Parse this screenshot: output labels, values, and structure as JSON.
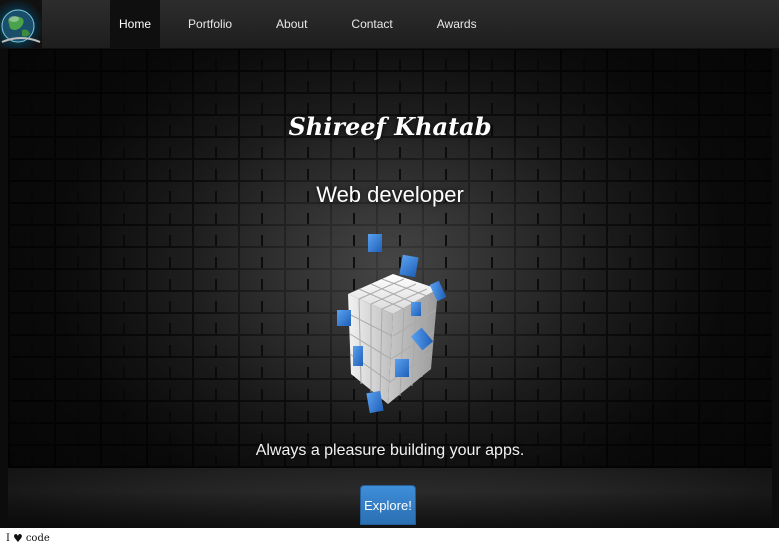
{
  "nav": {
    "logo_icon": "globe-logo-icon",
    "items": [
      {
        "label": "Home",
        "active": true
      },
      {
        "label": "Portfolio",
        "active": false
      },
      {
        "label": "About",
        "active": false
      },
      {
        "label": "Contact",
        "active": false
      },
      {
        "label": "Awards",
        "active": false
      }
    ]
  },
  "hero": {
    "name": "Shireef Khatab",
    "role": "Web developer",
    "image_icon": "cube-blocks-icon",
    "tagline": "Always a pleasure building your apps.",
    "button_label": "Explore!"
  },
  "footer": {
    "prefix": "I",
    "heart_icon": "heart-icon",
    "heart": "♥",
    "suffix": "code"
  },
  "colors": {
    "accent": "#3a86cf",
    "navbar": "#262626",
    "active_tab": "#0f0f0f"
  }
}
